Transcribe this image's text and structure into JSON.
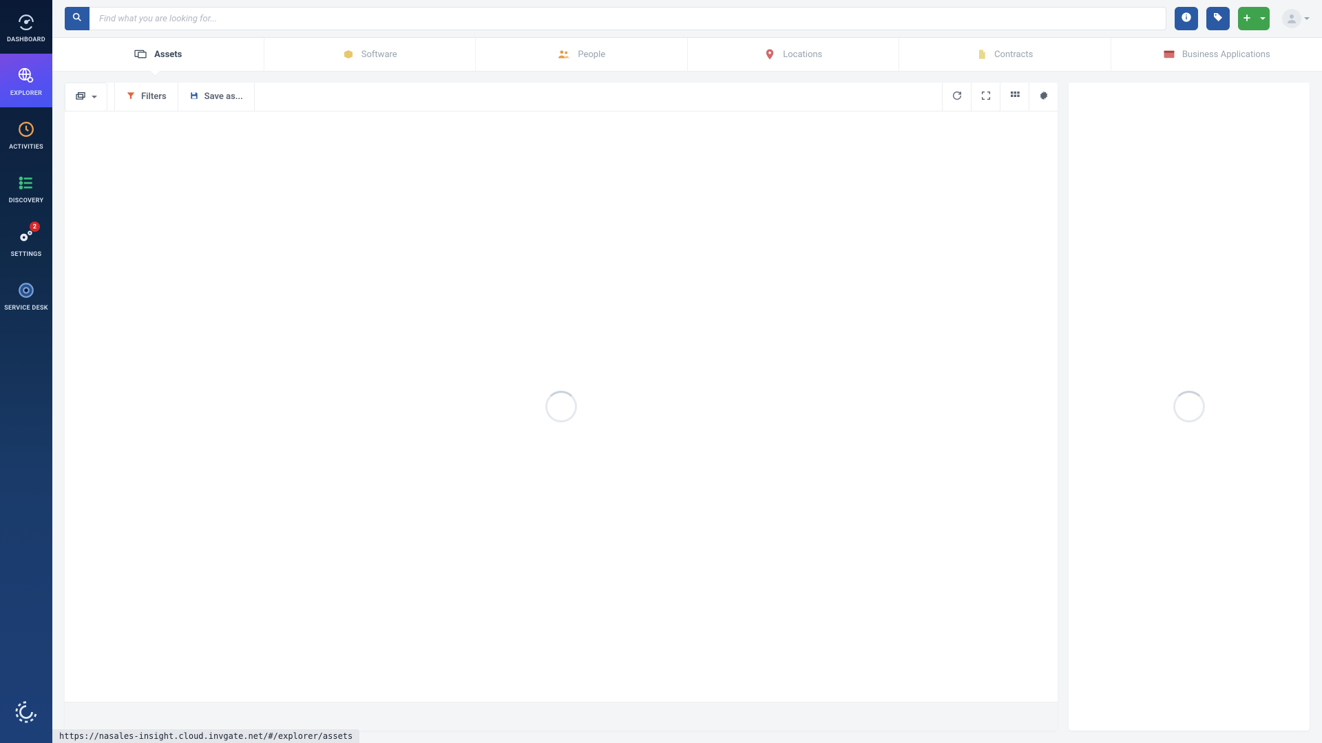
{
  "search": {
    "placeholder": "Find what you are looking for..."
  },
  "sidenav": {
    "items": [
      {
        "label": "DASHBOARD"
      },
      {
        "label": "EXPLORER"
      },
      {
        "label": "ACTIVITIES"
      },
      {
        "label": "DISCOVERY"
      },
      {
        "label": "SETTINGS",
        "badge": "2"
      },
      {
        "label": "SERVICE DESK"
      }
    ]
  },
  "categories": [
    {
      "label": "Assets"
    },
    {
      "label": "Software"
    },
    {
      "label": "People"
    },
    {
      "label": "Locations"
    },
    {
      "label": "Contracts"
    },
    {
      "label": "Business Applications"
    }
  ],
  "toolbar": {
    "filters_label": "Filters",
    "saveas_label": "Save as..."
  },
  "status_url": "https://nasales-insight.cloud.invgate.net/#/explorer/assets"
}
